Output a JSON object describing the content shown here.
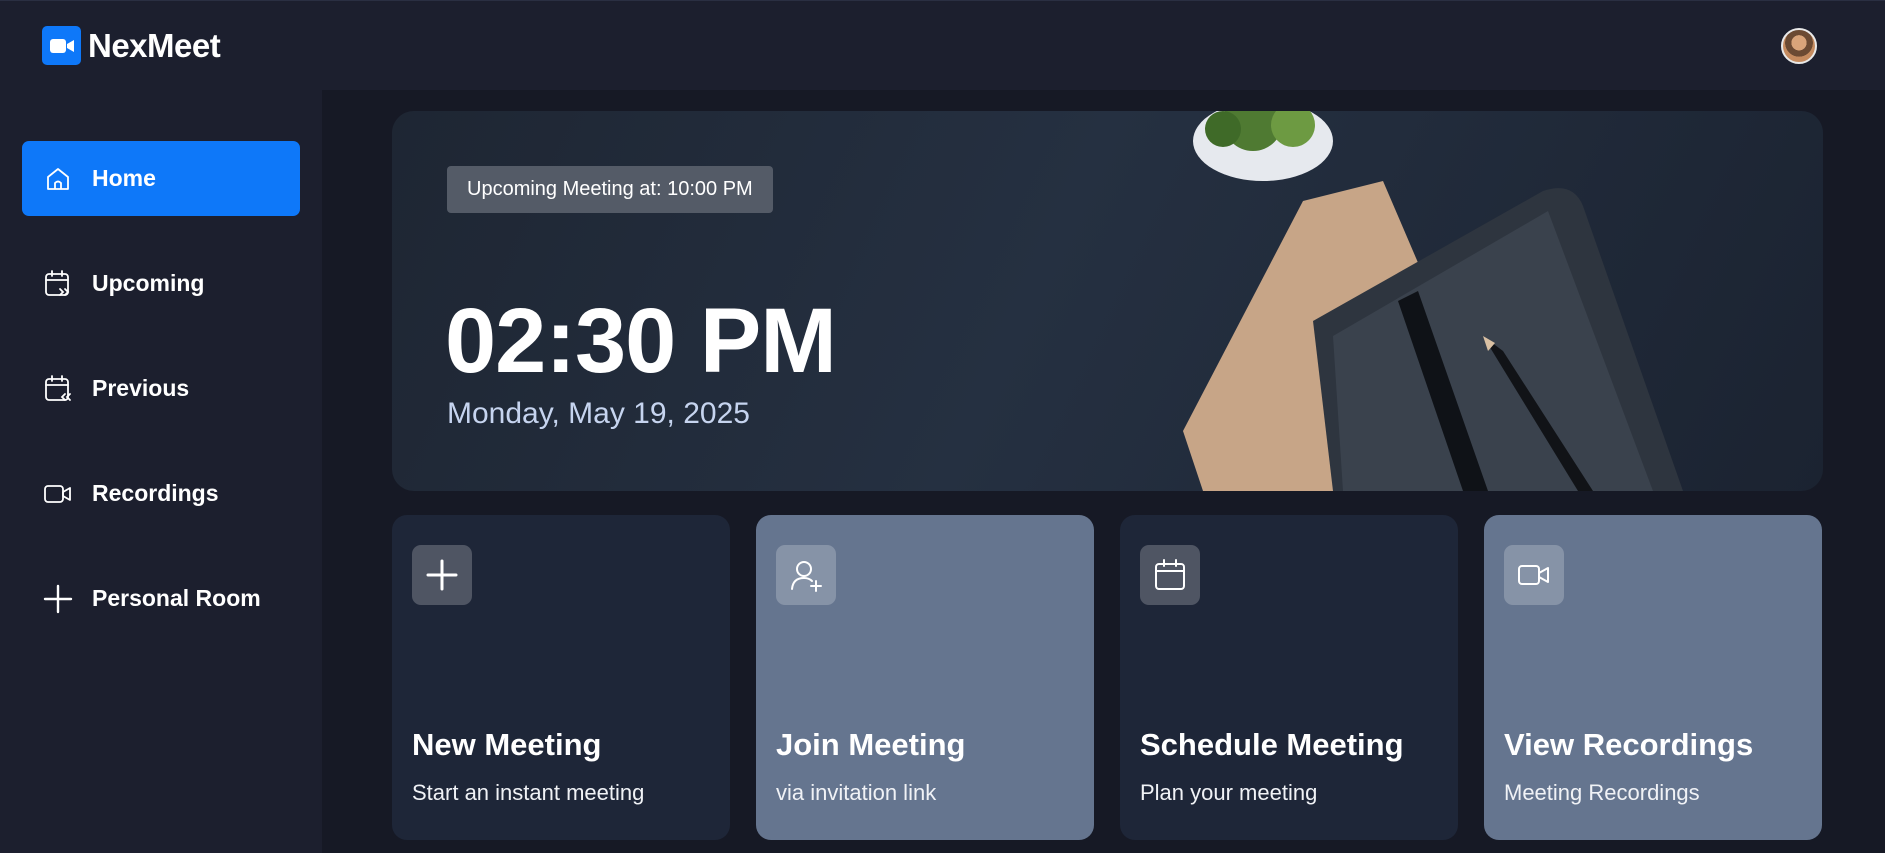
{
  "app": {
    "name": "NexMeet",
    "logo_icon": "video-camera-icon",
    "brand_color": "#0e78f9"
  },
  "user": {
    "avatar_icon": "user-avatar"
  },
  "sidebar": {
    "items": [
      {
        "label": "Home",
        "icon": "home-icon",
        "active": true
      },
      {
        "label": "Upcoming",
        "icon": "calendar-upcoming-icon",
        "active": false
      },
      {
        "label": "Previous",
        "icon": "calendar-previous-icon",
        "active": false
      },
      {
        "label": "Recordings",
        "icon": "video-icon",
        "active": false
      },
      {
        "label": "Personal Room",
        "icon": "plus-icon",
        "active": false
      }
    ]
  },
  "hero": {
    "badge": "Upcoming Meeting at: 10:00 PM",
    "time": "02:30 PM",
    "date": "Monday, May 19, 2025"
  },
  "cards": [
    {
      "title": "New Meeting",
      "subtitle": "Start an instant meeting",
      "icon": "plus-icon",
      "color": "#1e2638"
    },
    {
      "title": "Join Meeting",
      "subtitle": "via invitation link",
      "icon": "user-add-icon",
      "color": "#65758f"
    },
    {
      "title": "Schedule Meeting",
      "subtitle": "Plan your meeting",
      "icon": "calendar-icon",
      "color": "#1e2638"
    },
    {
      "title": "View Recordings",
      "subtitle": "Meeting Recordings",
      "icon": "video-icon",
      "color": "#65758f"
    }
  ],
  "colors": {
    "background": "#1c1f2e",
    "main_background": "#161925",
    "active_nav": "#0e78f9",
    "date_text": "#c6d4ef"
  }
}
